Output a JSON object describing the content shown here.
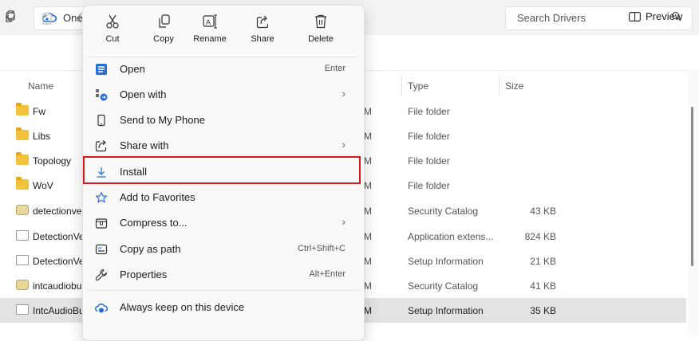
{
  "address": {
    "icon": "onedrive-cloud-icon",
    "text": "One"
  },
  "search": {
    "placeholder": "Search Drivers"
  },
  "command_bar": {
    "preview_label": "Preview"
  },
  "columns": {
    "name": "Name",
    "type": "Type",
    "size": "Size"
  },
  "rows": [
    {
      "name": "Fw",
      "icon": "folder",
      "date_fragment": "M",
      "type": "File folder",
      "size": ""
    },
    {
      "name": "Libs",
      "icon": "folder",
      "date_fragment": "M",
      "type": "File folder",
      "size": ""
    },
    {
      "name": "Topology",
      "icon": "folder",
      "date_fragment": "M",
      "type": "File folder",
      "size": ""
    },
    {
      "name": "WoV",
      "icon": "folder",
      "date_fragment": "M",
      "type": "File folder",
      "size": ""
    },
    {
      "name": "detectionve",
      "icon": "security-catalog",
      "date_fragment": "M",
      "type": "Security Catalog",
      "size": "43 KB"
    },
    {
      "name": "DetectionVe",
      "icon": "file",
      "date_fragment": "M",
      "type": "Application extens...",
      "size": "824 KB"
    },
    {
      "name": "DetectionVe",
      "icon": "file",
      "date_fragment": "M",
      "type": "Setup Information",
      "size": "21 KB"
    },
    {
      "name": "intcaudiobu",
      "icon": "security-catalog",
      "date_fragment": "M",
      "type": "Security Catalog",
      "size": "41 KB"
    },
    {
      "name": "IntcAudioBu",
      "icon": "file",
      "date_fragment": "M",
      "type": "Setup Information",
      "size": "35 KB",
      "selected": true
    }
  ],
  "context_menu": {
    "quick_actions": [
      {
        "label": "Cut",
        "icon": "scissors-icon"
      },
      {
        "label": "Copy",
        "icon": "copy-icon"
      },
      {
        "label": "Rename",
        "icon": "rename-icon"
      },
      {
        "label": "Share",
        "icon": "share-icon"
      },
      {
        "label": "Delete",
        "icon": "trash-icon"
      }
    ],
    "items": [
      {
        "label": "Open",
        "shortcut": "Enter",
        "icon": "open-app-icon",
        "submenu": false
      },
      {
        "label": "Open with",
        "shortcut": "",
        "icon": "open-with-icon",
        "submenu": true
      },
      {
        "label": "Send to My Phone",
        "shortcut": "",
        "icon": "phone-icon",
        "submenu": false
      },
      {
        "label": "Share with",
        "shortcut": "",
        "icon": "share-with-icon",
        "submenu": true
      },
      {
        "label": "Install",
        "shortcut": "",
        "icon": "download-icon",
        "submenu": false,
        "highlighted": true
      },
      {
        "label": "Add to Favorites",
        "shortcut": "",
        "icon": "star-icon",
        "submenu": false
      },
      {
        "label": "Compress to...",
        "shortcut": "",
        "icon": "zip-icon",
        "submenu": true
      },
      {
        "label": "Copy as path",
        "shortcut": "Ctrl+Shift+C",
        "icon": "copy-path-icon",
        "submenu": false
      },
      {
        "label": "Properties",
        "shortcut": "Alt+Enter",
        "icon": "wrench-icon",
        "submenu": false
      },
      {
        "label": "Always keep on this device",
        "shortcut": "",
        "icon": "sync-cloud-icon",
        "submenu": false
      }
    ]
  },
  "colors": {
    "highlight_border": "#d81b1b",
    "folder": "#f3c23d",
    "selected_row": "#e3e3e3",
    "onedrive_blue": "#1f6bd6"
  }
}
